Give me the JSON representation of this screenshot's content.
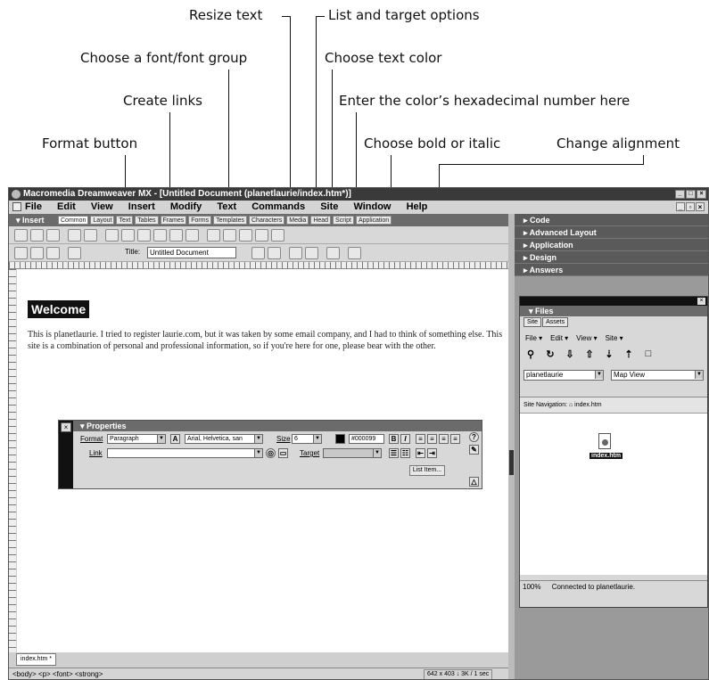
{
  "callouts": {
    "resize_text": "Resize text",
    "list_target": "List and target options",
    "choose_font": "Choose a font/font group",
    "choose_color": "Choose text color",
    "create_links": "Create links",
    "enter_hex": "Enter the color’s hexadecimal number here",
    "format_button": "Format button",
    "bold_italic": "Choose bold or italic",
    "alignment": "Change alignment"
  },
  "window": {
    "title": "Macromedia Dreamweaver MX - [Untitled Document (planetlaurie/index.htm*)]",
    "controls": [
      "_",
      "□",
      "×"
    ]
  },
  "menubar": {
    "items": [
      "File",
      "Edit",
      "View",
      "Insert",
      "Modify",
      "Text",
      "Commands",
      "Site",
      "Window",
      "Help"
    ],
    "right_controls": [
      "_",
      "▫",
      "×"
    ]
  },
  "insertbar": {
    "title": "▾ Insert",
    "tabs": [
      "Common",
      "Layout",
      "Text",
      "Tables",
      "Frames",
      "Forms",
      "Templates",
      "Characters",
      "Media",
      "Head",
      "Script",
      "Application"
    ]
  },
  "docbar": {
    "title_label": "Title:",
    "title_value": "Untitled Document"
  },
  "document": {
    "heading": "Welcome",
    "body": "This is planetlaurie. I tried to register laurie.com, but it was taken by some email company, and I had to think of something else. This site is a combination of personal and professional information, so if you're here for one, please bear with the other."
  },
  "properties": {
    "title": "▾ Properties",
    "format_label": "Format",
    "format_value": "Paragraph",
    "font_value": "Arial, Helvetica, san",
    "size_label": "Size",
    "size_value": "6",
    "color_value": "#000099",
    "bold": "B",
    "italic": "I",
    "link_label": "Link",
    "target_label": "Target",
    "list_item": "List Item..."
  },
  "doctab": "index.htm *",
  "status": {
    "tags": "<body> <p> <font> <strong>",
    "size": "642 x 403 ↓ 3K / 1 sec"
  },
  "right_panel": {
    "groups": [
      "▸ Code",
      "▸ Advanced Layout",
      "▸ Application",
      "▸ Design",
      "▸ Answers"
    ]
  },
  "files": {
    "title": "▾ Files",
    "tabs": [
      "Site",
      "Assets"
    ],
    "menu": [
      "File ▾",
      "Edit ▾",
      "View ▾",
      "Site ▾"
    ],
    "site": "planetlaurie",
    "view": "Map View",
    "nav_label": "Site Navigation:",
    "nav_file": "index.htm",
    "file_label": "index.htm",
    "zoom": "100%",
    "status": "Connected to planetlaurie."
  }
}
